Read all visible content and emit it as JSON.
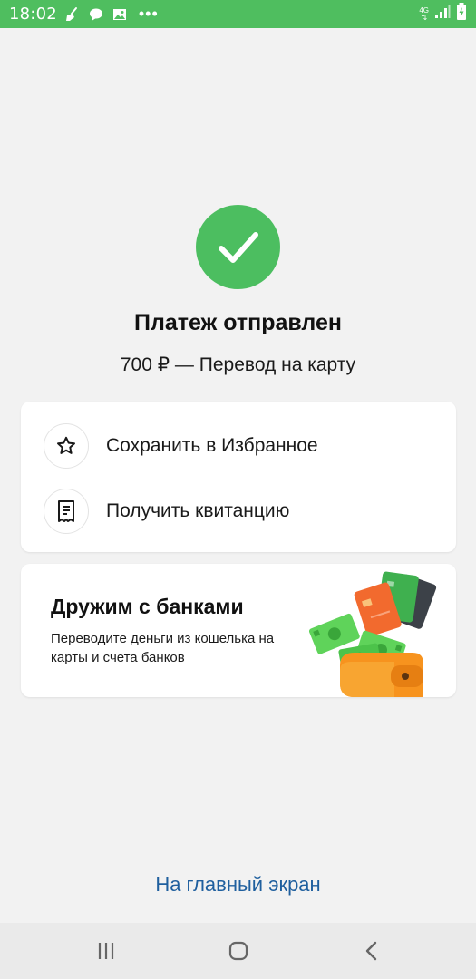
{
  "status_bar": {
    "time": "18:02",
    "network": "4G",
    "icons": [
      "broom-icon",
      "chat-bubble-icon",
      "image-icon",
      "more-dots-icon",
      "network-4g-icon",
      "signal-icon",
      "battery-charging-icon"
    ]
  },
  "result": {
    "title": "Платеж отправлен",
    "subtitle": "700 ₽ — Перевод на карту",
    "icon": "checkmark-icon"
  },
  "actions": [
    {
      "label": "Сохранить в Избранное",
      "icon": "star-icon"
    },
    {
      "label": "Получить квитанцию",
      "icon": "receipt-icon"
    }
  ],
  "promo": {
    "title": "Дружим с банками",
    "text": "Переводите деньги из кошелька на карты и счета банков"
  },
  "footer": {
    "home_link": "На главный экран"
  },
  "colors": {
    "status_bar": "#4fbe5f",
    "success": "#4cbe60",
    "link": "#1f5f9e",
    "background": "#f2f2f2"
  }
}
